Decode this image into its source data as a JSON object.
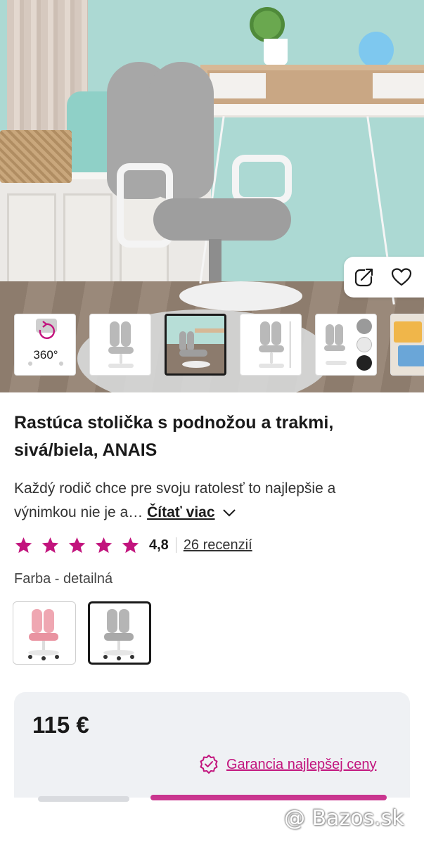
{
  "gallery": {
    "thumbnails": [
      {
        "label": "360°"
      },
      {
        "label": ""
      },
      {
        "label": ""
      },
      {
        "label": ""
      },
      {
        "label": ""
      },
      {
        "label": ""
      }
    ],
    "selected_index": 2
  },
  "product": {
    "title_line1": "Rastúca stolička s podnožou a trakmi,",
    "title_line2": "sivá/biela, ANAIS",
    "desc_line1": "Každý rodič chce pre svoju ratolesť to najlepšie a",
    "desc_line2": "výnimkou nie je a…",
    "read_more": "Čítať viac",
    "rating_value": "4,8",
    "rating_stars": 5,
    "reviews": "26 recenzií",
    "color_label": "Farba - detailná",
    "variants": [
      {
        "color": "pink",
        "selected": false
      },
      {
        "color": "gray",
        "selected": true
      }
    ]
  },
  "price": {
    "amount": "115 €",
    "guarantee": "Garancia najlepšej ceny"
  },
  "watermark": "@ Bazos.sk",
  "colors": {
    "accent": "#c2147d",
    "text": "#1a1a1a",
    "card_bg": "#eff1f4"
  }
}
